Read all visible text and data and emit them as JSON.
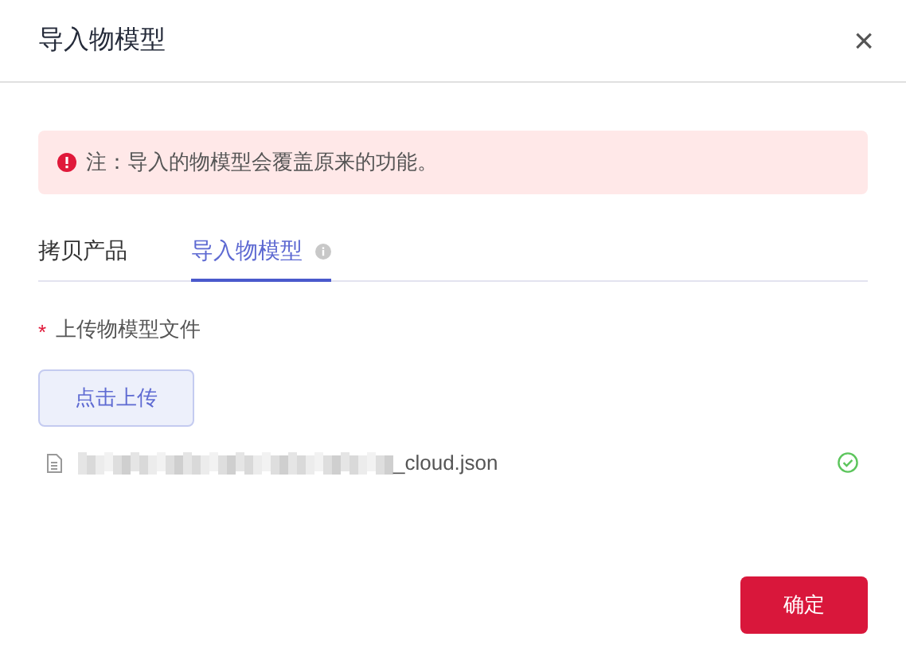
{
  "dialog": {
    "title": "导入物模型",
    "close": "×"
  },
  "alert": {
    "text": "注：导入的物模型会覆盖原来的功能。"
  },
  "tabs": [
    {
      "label": "拷贝产品",
      "selected": false,
      "info": false
    },
    {
      "label": "导入物模型",
      "selected": true,
      "info": true
    }
  ],
  "field": {
    "required_mark": "*",
    "label": "上传物模型文件"
  },
  "upload_button": "点击上传",
  "files": [
    {
      "name": "_cloud.json",
      "done": true
    }
  ],
  "confirm_button": "确定"
}
